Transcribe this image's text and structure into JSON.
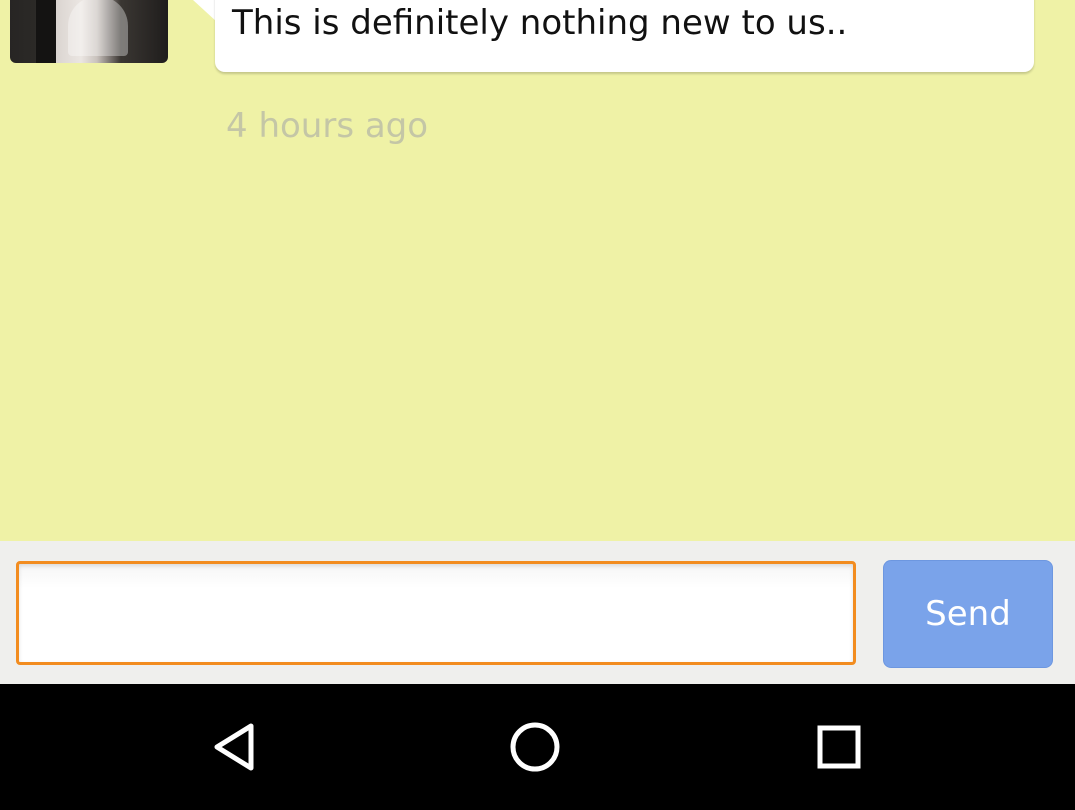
{
  "conversation": {
    "message": {
      "text": "This is definitely nothing new to us..",
      "timestamp": "4 hours ago"
    }
  },
  "composer": {
    "input_value": "",
    "input_placeholder": "",
    "send_label": "Send"
  },
  "navigation": {
    "back_icon": "back-triangle-icon",
    "home_icon": "home-circle-icon",
    "recent_icon": "recent-apps-square-icon"
  },
  "colors": {
    "chat_background": "#eff2a6",
    "input_border": "#f28c1f",
    "send_button": "#7aa3ea",
    "nav_background": "#000000",
    "timestamp_text": "#c4c6a6"
  }
}
